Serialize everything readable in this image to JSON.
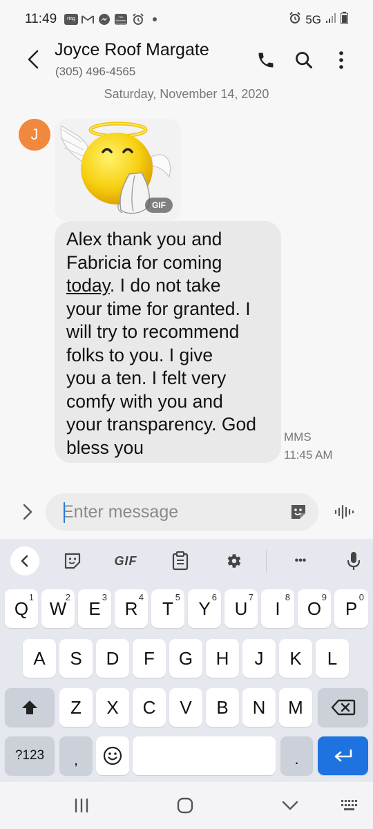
{
  "status_bar": {
    "time": "11:49",
    "left_icons": [
      "ring-icon",
      "gmail-icon",
      "messenger-icon",
      "weather-channel-icon",
      "alarm-icon",
      "dot-icon"
    ],
    "ring_label": "ring",
    "weather_label": "The Weather Channel",
    "network": "5G",
    "right_icons": [
      "alarm-icon",
      "signal-icon",
      "battery-icon"
    ]
  },
  "header": {
    "contact_name": "Joyce Roof Margate",
    "phone": "(305) 496-4565",
    "icons": [
      "back-arrow-icon",
      "phone-icon",
      "search-icon",
      "more-vert-icon"
    ]
  },
  "conversation": {
    "date": "Saturday, November 14, 2020",
    "avatar_initial": "J",
    "avatar_color": "#f0883e",
    "gif_badge": "GIF",
    "message_lines": [
      "Alex thank you and",
      "Fabricia for coming",
      "today",
      ". I do not take",
      "your time for granted. I",
      "will try to recommend",
      "folks to you. I give",
      "you a ten. I felt very",
      "comfy with you and",
      "your transparency. God",
      "bless you"
    ],
    "message_type": "MMS",
    "message_time": "11:45 AM"
  },
  "compose": {
    "placeholder": "Enter message",
    "value": ""
  },
  "keyboard": {
    "toolbar": {
      "gif_label": "GIF",
      "icons": [
        "chevron-left-icon",
        "emoji-sticker-icon",
        "gif-icon",
        "clipboard-icon",
        "settings-gear-icon",
        "more-horiz-icon",
        "microphone-icon"
      ],
      "more_label": "•••"
    },
    "row1": [
      "Q",
      "W",
      "E",
      "R",
      "T",
      "Y",
      "U",
      "I",
      "O",
      "P"
    ],
    "row1_digits": [
      "1",
      "2",
      "3",
      "4",
      "5",
      "6",
      "7",
      "8",
      "9",
      "0"
    ],
    "row2": [
      "A",
      "S",
      "D",
      "F",
      "G",
      "H",
      "J",
      "K",
      "L"
    ],
    "row3": [
      "Z",
      "X",
      "C",
      "V",
      "B",
      "N",
      "M"
    ],
    "symbols_label": "?123",
    "comma": ",",
    "period": ".",
    "accent_color": "#1e73e0"
  },
  "navbar": {
    "icons": [
      "recents-icon",
      "home-icon",
      "back-down-icon",
      "keyboard-switch-icon"
    ]
  }
}
